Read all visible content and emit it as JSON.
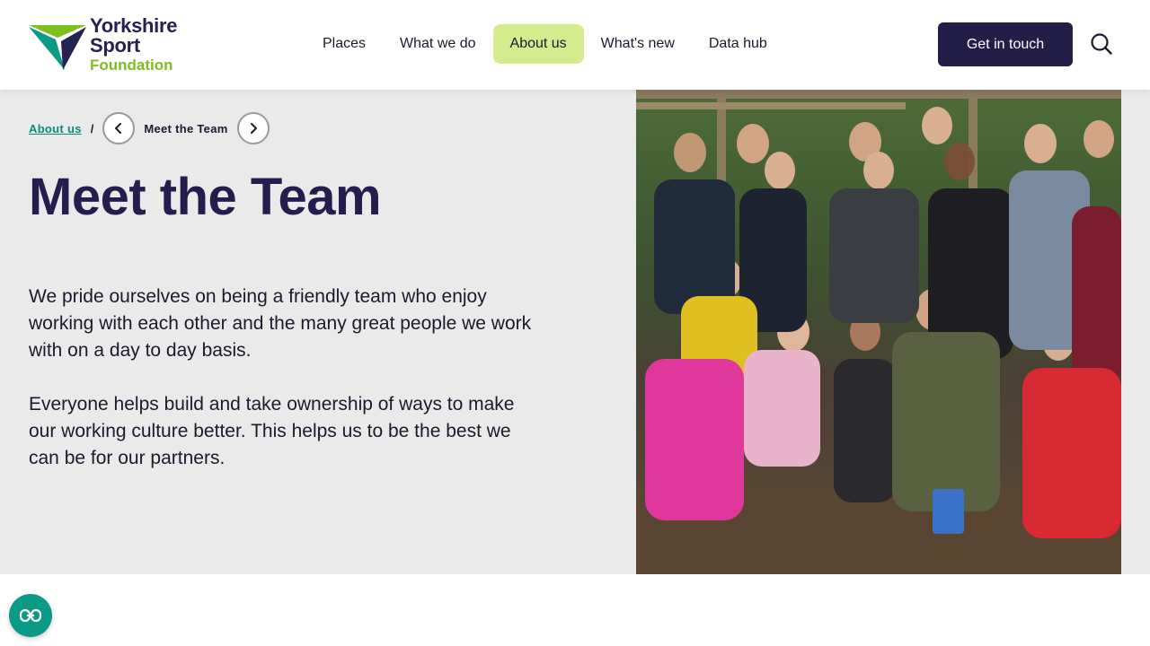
{
  "brand": {
    "line1": "Yorkshire",
    "line2": "Sport",
    "line3": "Foundation",
    "colors": {
      "navy": "#231e48",
      "green": "#7dbf1f",
      "teal": "#0b9a86"
    }
  },
  "nav": {
    "items": [
      {
        "label": "Places"
      },
      {
        "label": "What we do"
      },
      {
        "label": "About us",
        "active": true
      },
      {
        "label": "What's new"
      },
      {
        "label": "Data hub"
      }
    ]
  },
  "header": {
    "cta_label": "Get in touch",
    "search_icon": "search-icon"
  },
  "breadcrumb": {
    "parent": "About us",
    "separator": "/",
    "current": "Meet the Team",
    "prev_icon": "chevron-left-icon",
    "next_icon": "chevron-right-icon"
  },
  "hero": {
    "title": "Meet the Team",
    "paragraph1": "We pride ourselves on being a friendly team who enjoy working with each other and the many great people we work with on a day to day basis.",
    "paragraph2": "Everyone helps build and take ownership of ways to make our working culture better. This helps us to be the best we can be for our partners.",
    "image": "team-group-photo"
  },
  "accessibility": {
    "icon": "accessibility-icon"
  }
}
